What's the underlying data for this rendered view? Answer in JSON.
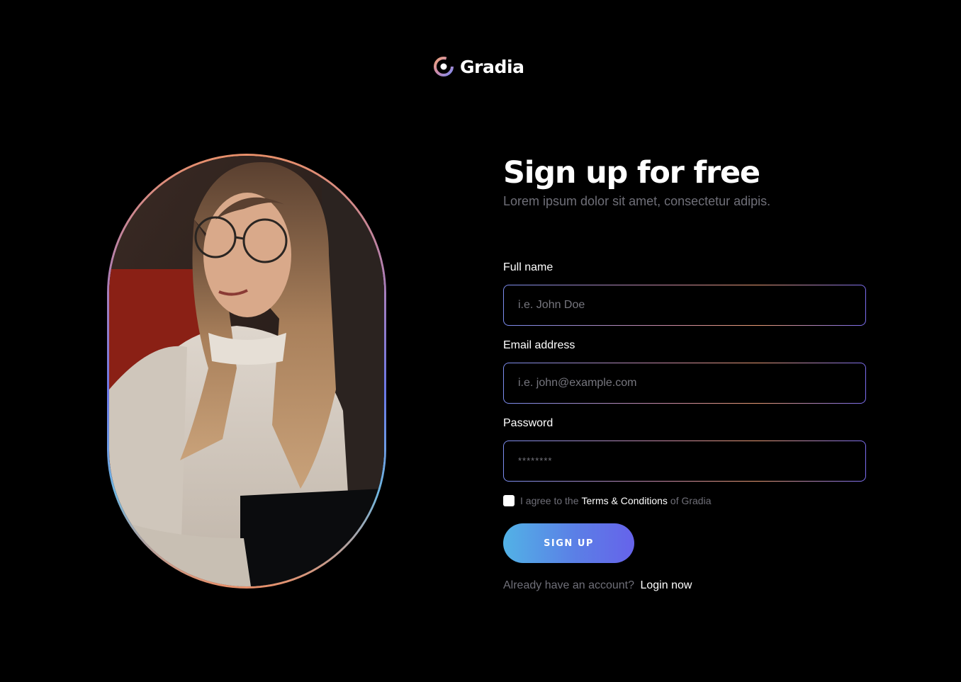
{
  "brand": {
    "name": "Gradia",
    "logo_icon": "gradia-logo-icon"
  },
  "hero": {
    "image": "woman-with-glasses-photo"
  },
  "form": {
    "title": "Sign up for free",
    "subtitle": "Lorem ipsum dolor sit amet, consectetur adipis.",
    "fields": {
      "full_name": {
        "label": "Full name",
        "placeholder": "i.e. John Doe",
        "value": ""
      },
      "email": {
        "label": "Email address",
        "placeholder": "i.e. john@example.com",
        "value": ""
      },
      "password": {
        "label": "Password",
        "placeholder": "********",
        "value": ""
      }
    },
    "agree": {
      "checked": false,
      "pre": "I agree to the",
      "link": "Terms & Conditions",
      "post": "of Gradia"
    },
    "submit_label": "SIGN UP",
    "login": {
      "prompt": "Already have an account?",
      "link": "Login now"
    }
  },
  "colors": {
    "background": "#000000",
    "button_start": "#52b2e6",
    "button_end": "#6663ea",
    "muted_text": "#6f6f78"
  }
}
